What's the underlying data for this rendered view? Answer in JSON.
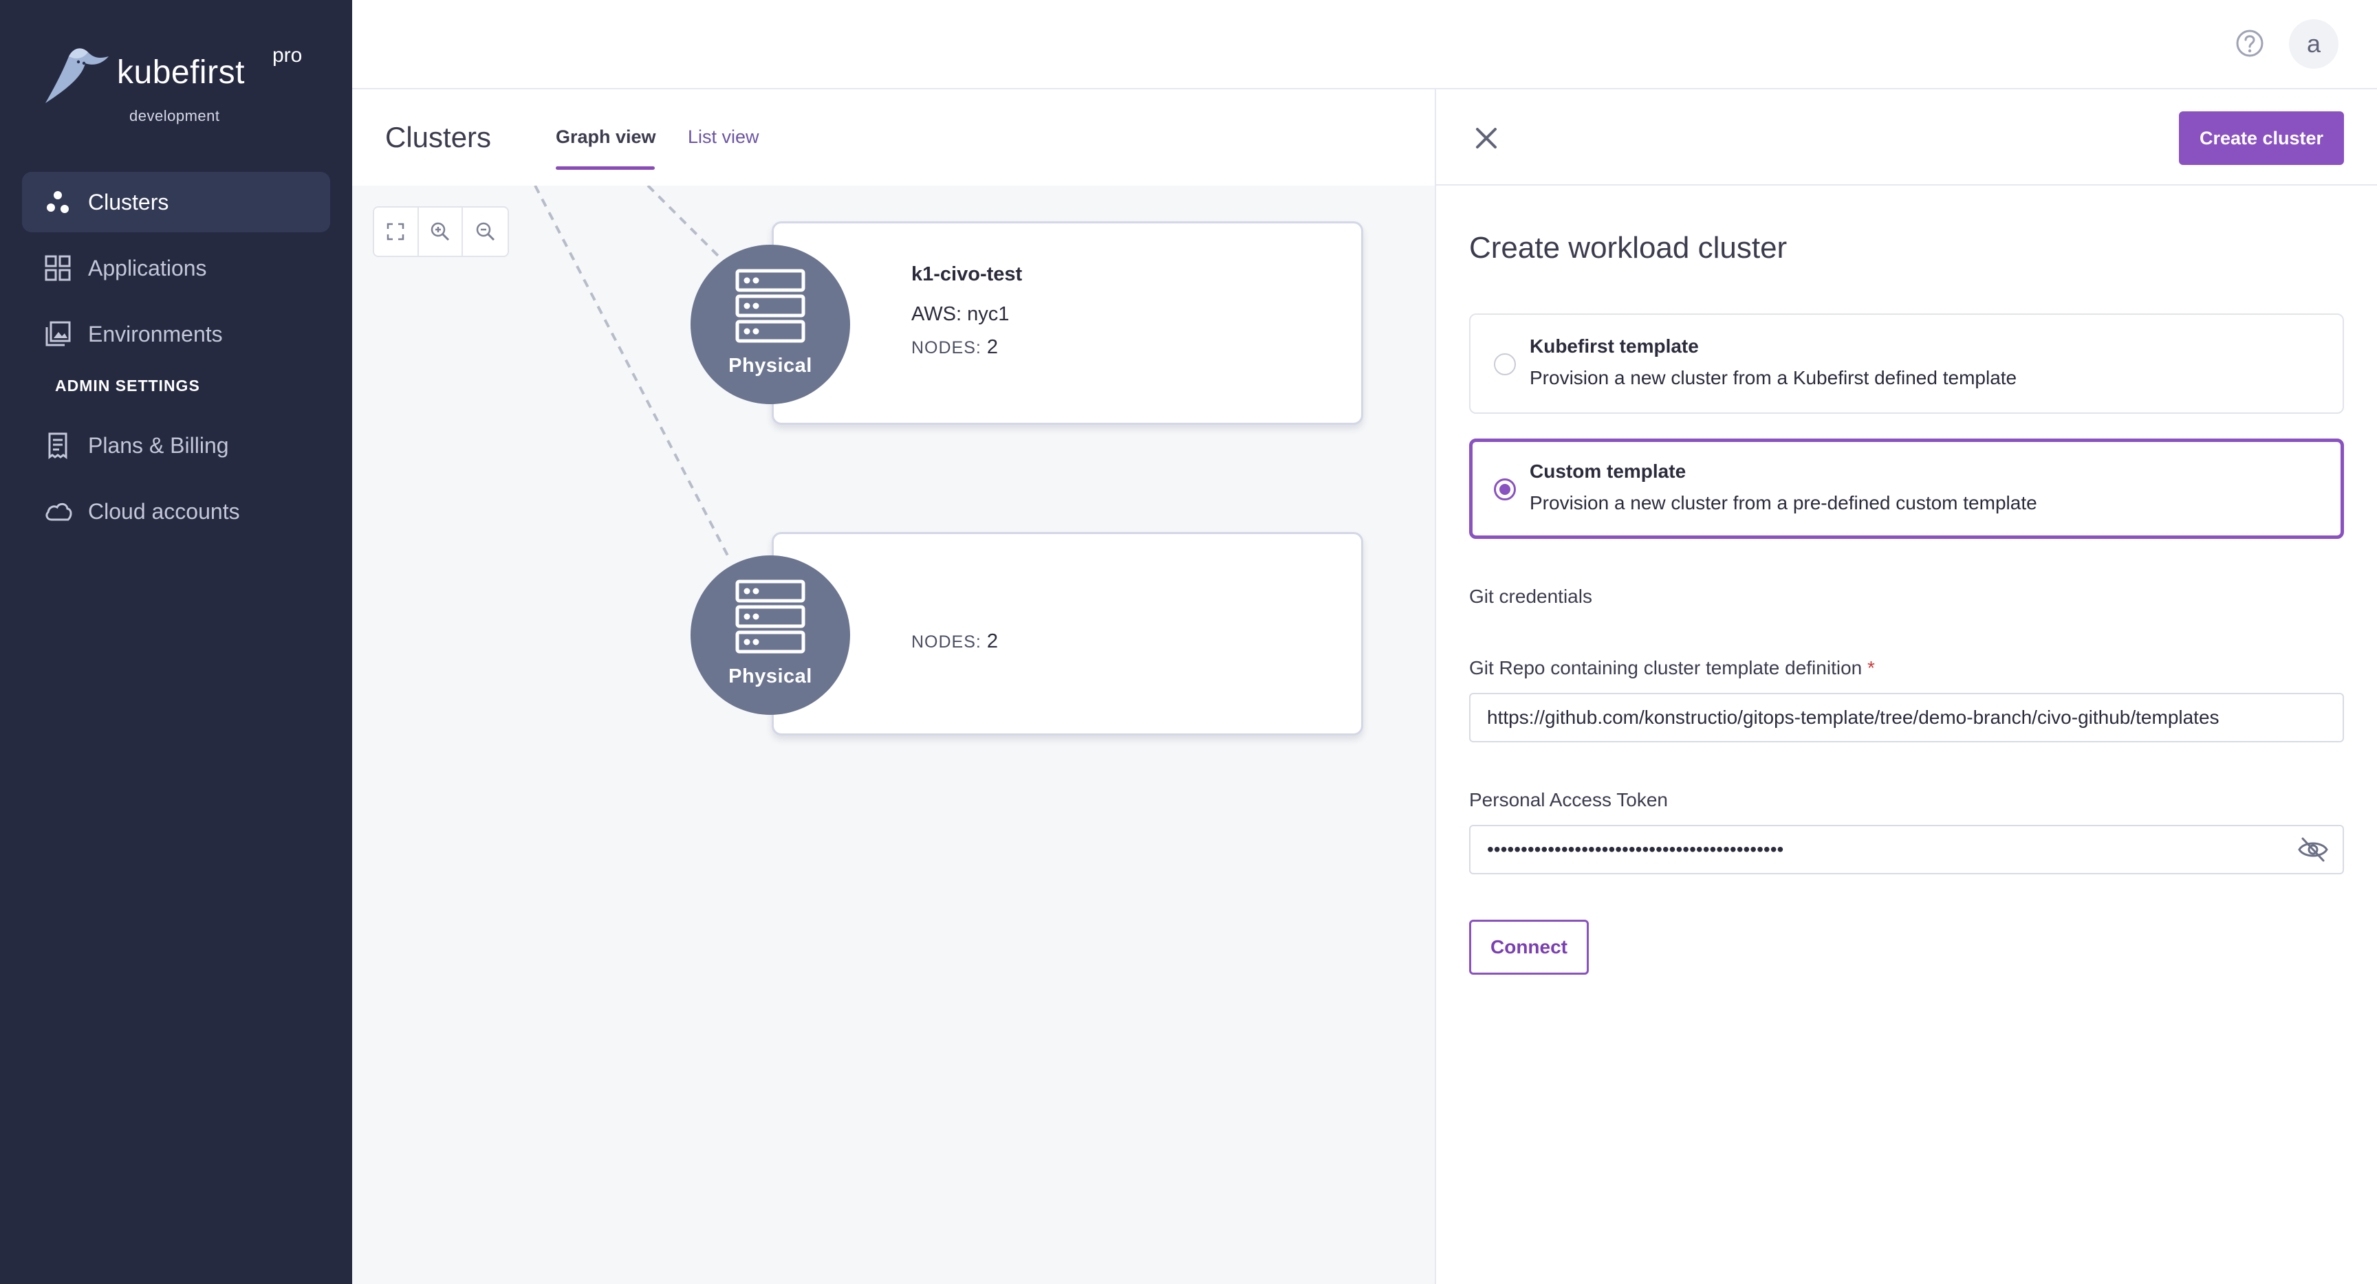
{
  "brand": {
    "name": "kubefirst",
    "tier": "pro",
    "environment": "development"
  },
  "sidebar": {
    "items": [
      {
        "label": "Clusters",
        "icon": "clusters-icon",
        "active": true
      },
      {
        "label": "Applications",
        "icon": "applications-grid-icon",
        "active": false
      },
      {
        "label": "Environments",
        "icon": "environments-icon",
        "active": false
      }
    ],
    "admin_heading": "ADMIN SETTINGS",
    "admin_items": [
      {
        "label": "Plans & Billing",
        "icon": "billing-receipt-icon"
      },
      {
        "label": "Cloud accounts",
        "icon": "cloud-icon"
      }
    ]
  },
  "topbar": {
    "help_icon": "help-circle-icon",
    "avatar_initial": "a"
  },
  "page": {
    "title": "Clusters",
    "tabs": [
      {
        "label": "Graph view",
        "active": true
      },
      {
        "label": "List view",
        "active": false
      }
    ]
  },
  "graph": {
    "zoom_controls": [
      "fit-view-icon",
      "zoom-in-icon",
      "zoom-out-icon"
    ],
    "clusters": [
      {
        "node_label": "Physical",
        "name": "k1-civo-test",
        "provider_label": "AWS:",
        "region": "nyc1",
        "nodes_label": "NODES:",
        "nodes": "2"
      },
      {
        "node_label": "Physical",
        "name": "",
        "provider_label": "",
        "region": "",
        "nodes_label": "NODES:",
        "nodes": "2"
      }
    ]
  },
  "drawer": {
    "close_icon": "close-icon",
    "create_button": "Create cluster",
    "title": "Create workload cluster",
    "options": [
      {
        "title": "Kubefirst template",
        "description": "Provision a new cluster from a Kubefirst defined template",
        "selected": false
      },
      {
        "title": "Custom template",
        "description": "Provision a new cluster from a pre-defined custom template",
        "selected": true
      }
    ],
    "git_credentials_heading": "Git credentials",
    "repo_label": "Git Repo containing cluster template definition",
    "repo_required_mark": "*",
    "repo_value": "https://github.com/konstructio/gitops-template/tree/demo-branch/civo-github/templates",
    "token_label": "Personal Access Token",
    "token_value": "••••••••••••••••••••••••••••••••••••••••••••",
    "token_visibility_icon": "eye-off-icon",
    "connect_button": "Connect"
  },
  "colors": {
    "sidebar_bg": "#252a41",
    "accent_purple": "#8a51c1",
    "node_gray": "#6b7590",
    "canvas_bg": "#f6f7f9"
  }
}
